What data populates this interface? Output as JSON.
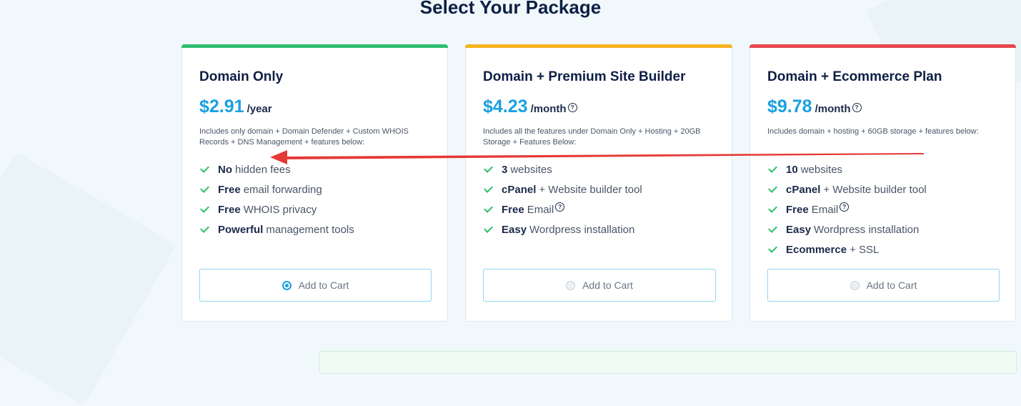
{
  "page_title": "Select Your Package",
  "colors": {
    "accent": "#1aa0e0",
    "check": "#2dbd6e",
    "annotation_arrow": "#e53935"
  },
  "packages": [
    {
      "title": "Domain Only",
      "bar_color": "#2dbd6e",
      "price": "$2.91",
      "period": "/year",
      "has_help": false,
      "description": "Includes only domain + Domain Defender + Custom WHOIS Records + DNS Management + features below:",
      "features": [
        {
          "strong": "No",
          "text": "hidden fees",
          "help": false
        },
        {
          "strong": "Free",
          "text": "email forwarding",
          "help": false
        },
        {
          "strong": "Free",
          "text": "WHOIS privacy",
          "help": false
        },
        {
          "strong": "Powerful",
          "text": "management tools",
          "help": false
        }
      ],
      "button_label": "Add to Cart",
      "selected": true
    },
    {
      "title": "Domain + Premium Site Builder",
      "bar_color": "#f5b21c",
      "price": "$4.23",
      "period": "/month",
      "has_help": true,
      "description": "Includes all the features under Domain Only + Hosting + 20GB Storage + Features Below:",
      "features": [
        {
          "strong": "3",
          "text": "websites",
          "help": false
        },
        {
          "strong": "cPanel",
          "text": "+ Website builder tool",
          "help": false
        },
        {
          "strong": "Free",
          "text": "Email",
          "help": true
        },
        {
          "strong": "Easy",
          "text": "Wordpress installation",
          "help": false
        }
      ],
      "button_label": "Add to Cart",
      "selected": false
    },
    {
      "title": "Domain + Ecommerce Plan",
      "bar_color": "#e5484d",
      "price": "$9.78",
      "period": "/month",
      "has_help": true,
      "description": "Includes domain + hosting + 60GB storage + features below:",
      "features": [
        {
          "strong": "10",
          "text": "websites",
          "help": false
        },
        {
          "strong": "cPanel",
          "text": "+ Website builder tool",
          "help": false
        },
        {
          "strong": "Free",
          "text": "Email",
          "help": true
        },
        {
          "strong": "Easy",
          "text": "Wordpress installation",
          "help": false
        },
        {
          "strong": "Ecommerce",
          "text": "+ SSL",
          "help": false
        }
      ],
      "button_label": "Add to Cart",
      "selected": false
    }
  ],
  "help_glyph": "?"
}
